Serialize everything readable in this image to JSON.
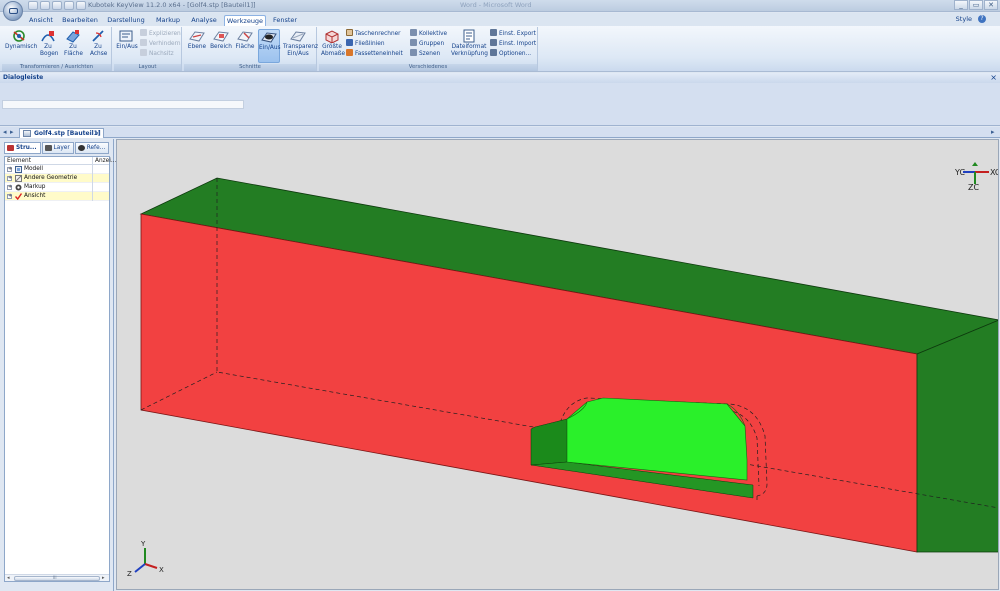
{
  "window": {
    "title": "Kubotek KeyView 11.2.0 x64 - [Golf4.stp [Bauteil1]]",
    "ghost_title": "Word - Microsoft Word",
    "controls": [
      "_",
      "▭",
      "✕"
    ]
  },
  "ribbon_tabs": [
    "Ansicht",
    "Bearbeiten",
    "Darstellung",
    "Markup",
    "Analyse",
    "Werkzeuge",
    "Fenster"
  ],
  "active_tab": "Werkzeuge",
  "style_menu": "Style",
  "help_label": "?",
  "groups": {
    "transform": {
      "label": "Transformieren / Ausrichten",
      "buttons": [
        "Dynamisch",
        "Zu Bogen",
        "Zu Fläche",
        "Zu Achse"
      ]
    },
    "layout": {
      "label": "Layout",
      "button": "Ein/Aus",
      "smalls": [
        "Explizieren",
        "Verhindern",
        "Nachsitz"
      ]
    },
    "schnitte": {
      "label": "Schnitte",
      "buttons": [
        "Ebene",
        "Bereich",
        "Fläche",
        "Ein/Aus",
        "Transparenz Ein/Aus"
      ]
    },
    "verschiedenes": {
      "label": "Verschiedenes",
      "big1": "Größte Abmaße",
      "smalls_col1": [
        "Taschenrechner",
        "Fließlinien",
        "Fassetteneinheit"
      ],
      "smalls_col2": [
        "Kollektive",
        "Gruppen",
        "Szenen"
      ],
      "big2": "Dateiformat Verknüpfung",
      "smalls_col3": [
        "Einst. Export",
        "Einst. Import",
        "Optionen..."
      ]
    }
  },
  "dialog_bar": {
    "title": "Dialogleiste",
    "close": "×"
  },
  "doc_tab": {
    "label": "Golf4.stp [Bauteil1]",
    "close": "×"
  },
  "panel_tabs": [
    "Stru...",
    "Layer",
    "Refe..."
  ],
  "tree": {
    "headers": [
      "Element",
      "Anzei..."
    ],
    "rows": [
      {
        "label": "Modell",
        "highlighted": false
      },
      {
        "label": "Andere Geometrie",
        "highlighted": true
      },
      {
        "label": "Markup",
        "highlighted": false
      },
      {
        "label": "Ansicht",
        "highlighted": true
      }
    ]
  },
  "scrollbar": {
    "thumb_label": "III"
  },
  "triad_top": {
    "x": "XC",
    "y": "YC",
    "z": "ZC"
  },
  "triad_bottom": {
    "x": "X",
    "y": "Y",
    "z": "Z"
  },
  "colors": {
    "face_front": "#f24141",
    "face_top": "#237d23",
    "face_side": "#237d23",
    "pocket": "#2af02a",
    "viewport_bg": "#dcdcdc"
  }
}
